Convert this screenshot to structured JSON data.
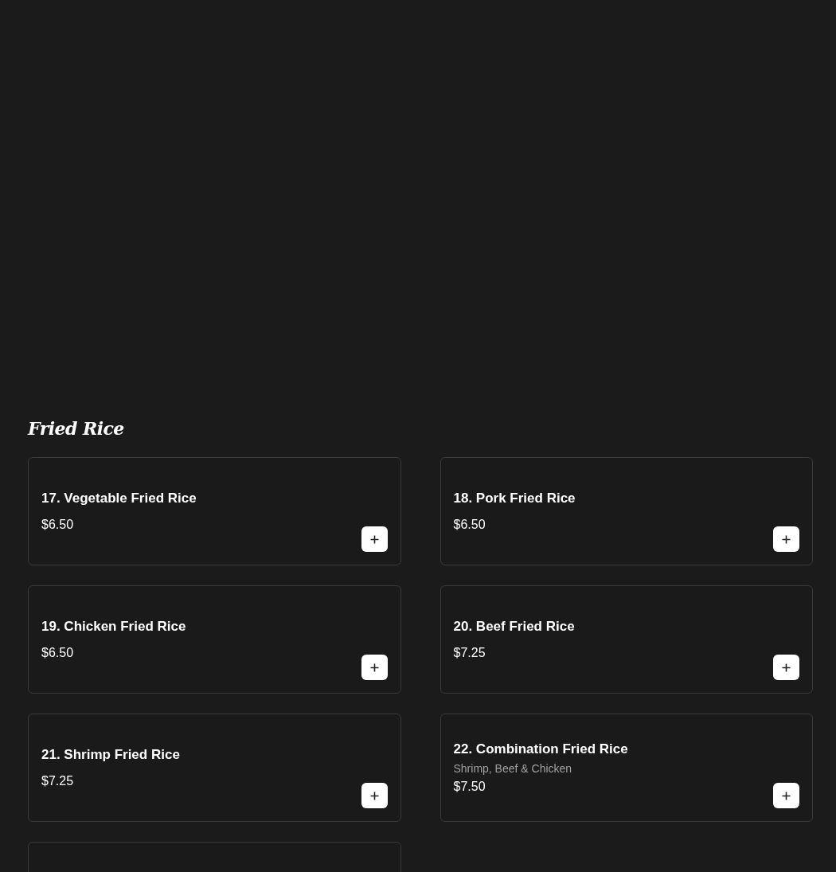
{
  "section": {
    "title": "Fried Rice",
    "items": [
      {
        "name": "17. Vegetable Fried Rice",
        "price": "$6.50"
      },
      {
        "name": "18. Pork Fried Rice",
        "price": "$6.50"
      },
      {
        "name": "19. Chicken Fried Rice",
        "price": "$6.50"
      },
      {
        "name": "20. Beef Fried Rice",
        "price": "$7.25"
      },
      {
        "name": "21. Shrimp Fried Rice",
        "price": "$7.25"
      },
      {
        "name": "22. Combination Fried Rice",
        "description": "Shrimp, Beef & Chicken",
        "price": "$7.50"
      }
    ],
    "more_below": true
  }
}
